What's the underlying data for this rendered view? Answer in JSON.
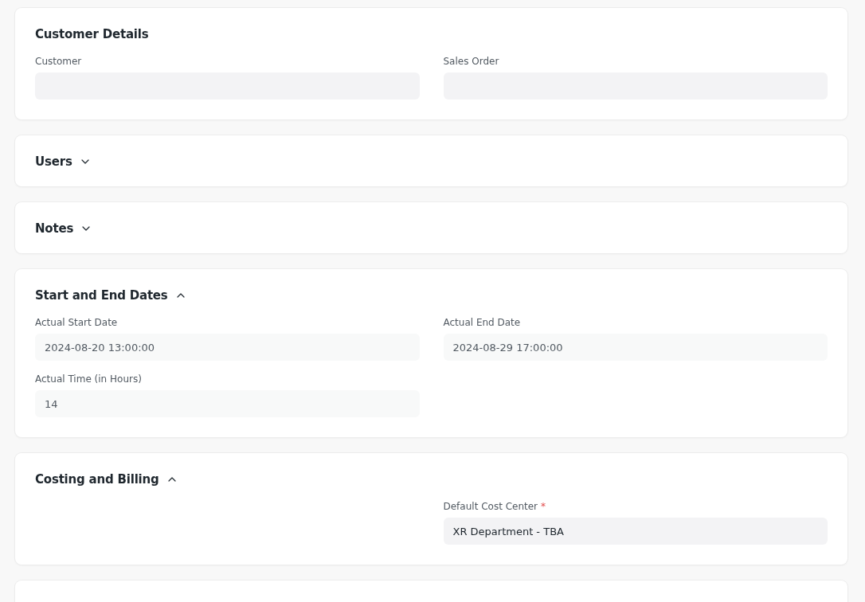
{
  "sections": [
    {
      "kind": "static",
      "title": "Customer Details",
      "left_fields": [
        {
          "label": "Customer"
        }
      ],
      "right_fields": [
        {
          "label": "Sales Order"
        }
      ]
    },
    {
      "kind": "collapsible",
      "title": "Users",
      "expanded": false
    },
    {
      "kind": "collapsible",
      "title": "Notes",
      "expanded": false
    },
    {
      "kind": "collapsible",
      "title": "Start and End Dates",
      "expanded": true,
      "left_fields": [
        {
          "label": "Actual Start Date",
          "value": "2024-08-20 13:00:00",
          "read_only": true
        },
        {
          "label": "Actual Time (in Hours)",
          "value": "14",
          "read_only": true
        }
      ],
      "right_fields": [
        {
          "label": "Actual End Date",
          "value": "2024-08-29 17:00:00",
          "read_only": true
        }
      ]
    },
    {
      "kind": "collapsible",
      "title": "Costing and Billing",
      "expanded": true,
      "right_fields": [
        {
          "label": "Default Cost Center",
          "required_mark": "*",
          "value": "XR Department - TBA",
          "read_only": false
        }
      ]
    },
    {
      "kind": "clipped"
    }
  ]
}
